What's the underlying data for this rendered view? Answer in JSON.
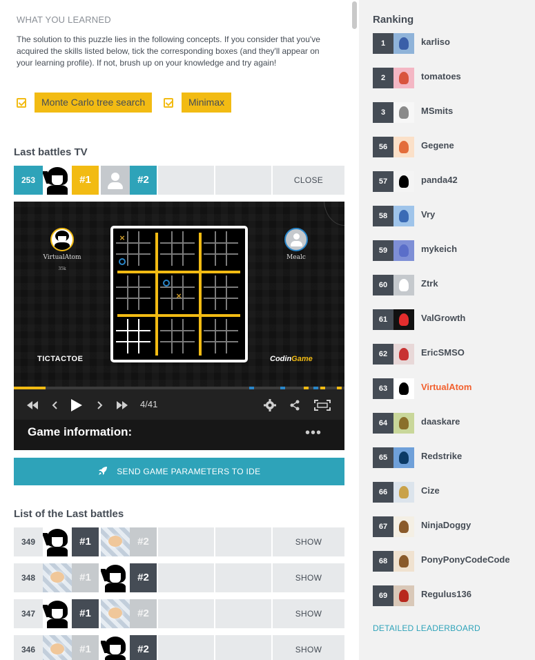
{
  "learned": {
    "title": "WHAT YOU LEARNED",
    "text": "The solution to this puzzle lies in the following concepts. If you consider that you've acquired the skills listed below, tick the corresponding boxes (and they'll appear on your learning profile). If not, brush up on your knowledge and try again!",
    "concepts": [
      {
        "label": "Monte Carlo tree search",
        "checked": true
      },
      {
        "label": "Minimax",
        "checked": true
      }
    ]
  },
  "last_battles_tv": {
    "title": "Last battles TV",
    "rank": "253",
    "p1_pos": "#1",
    "p2_pos": "#2",
    "action": "CLOSE"
  },
  "viewer": {
    "player1": {
      "name": "VirtualAtom",
      "sub": "35k"
    },
    "player2": {
      "name": "Mealc"
    },
    "logo_left": "TICTACTOE",
    "logo_right_a": "Codin",
    "logo_right_b": "Game",
    "frame": "4/41",
    "game_info": "Game information:",
    "dots": "•••",
    "colors": {
      "board_accent": "#f2bb13",
      "x_mark": "#c9992a",
      "o_mark": "#2a86c9"
    }
  },
  "send_button": "SEND GAME PARAMETERS TO IDE",
  "battles_list": {
    "title": "List of the Last battles",
    "rows": [
      {
        "id": "349",
        "p1": "#1",
        "p2": "#2",
        "action": "SHOW"
      },
      {
        "id": "348",
        "p1": "#1",
        "p2": "#2",
        "action": "SHOW"
      },
      {
        "id": "347",
        "p1": "#1",
        "p2": "#2",
        "action": "SHOW"
      },
      {
        "id": "346",
        "p1": "#1",
        "p2": "#2",
        "action": "SHOW"
      }
    ]
  },
  "ranking": {
    "title": "Ranking",
    "rows": [
      {
        "rank": "1",
        "name": "karliso"
      },
      {
        "rank": "2",
        "name": "tomatoes"
      },
      {
        "rank": "3",
        "name": "MSmits"
      },
      {
        "rank": "56",
        "name": "Gegene"
      },
      {
        "rank": "57",
        "name": "panda42"
      },
      {
        "rank": "58",
        "name": "Vry"
      },
      {
        "rank": "59",
        "name": "mykeich"
      },
      {
        "rank": "60",
        "name": "Ztrk"
      },
      {
        "rank": "61",
        "name": "ValGrowth"
      },
      {
        "rank": "62",
        "name": "EricSMSO"
      },
      {
        "rank": "63",
        "name": "VirtualAtom"
      },
      {
        "rank": "64",
        "name": "daaskare"
      },
      {
        "rank": "65",
        "name": "Redstrike"
      },
      {
        "rank": "66",
        "name": "Cize"
      },
      {
        "rank": "67",
        "name": "NinjaDoggy"
      },
      {
        "rank": "68",
        "name": "PonyPonyCodeCode"
      },
      {
        "rank": "69",
        "name": "Regulus136"
      }
    ],
    "detailed_link": "DETAILED LEADERBOARD",
    "colors": {
      "highlight": "#f2602e",
      "link": "#2ea3b9"
    }
  }
}
